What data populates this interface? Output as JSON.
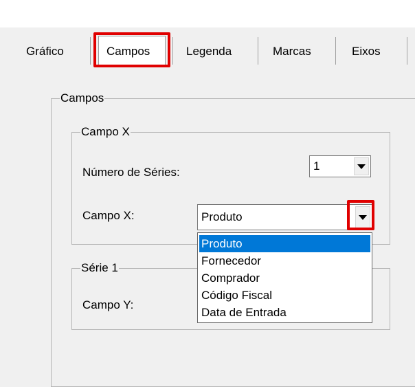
{
  "tabs": [
    {
      "label": "Gráfico",
      "selected": false
    },
    {
      "label": "Campos",
      "selected": true
    },
    {
      "label": "Legenda",
      "selected": false
    },
    {
      "label": "Marcas",
      "selected": false
    },
    {
      "label": "Eixos",
      "selected": false
    }
  ],
  "campos_group": {
    "title": "Campos"
  },
  "campo_x_group": {
    "title": "Campo X",
    "num_series_label": "Número de Séries:",
    "num_series_value": "1",
    "campo_x_label": "Campo X:",
    "campo_x_value": "Produto"
  },
  "serie_group": {
    "title": "Série 1",
    "campo_y_label": "Campo Y:"
  },
  "dropdown": {
    "options": [
      "Produto",
      "Fornecedor",
      "Comprador",
      "Código Fiscal",
      "Data de Entrada"
    ],
    "selected_index": 0
  },
  "colors": {
    "highlight": "#e00000",
    "selection": "#0078d7",
    "background": "#f0f0f0"
  }
}
